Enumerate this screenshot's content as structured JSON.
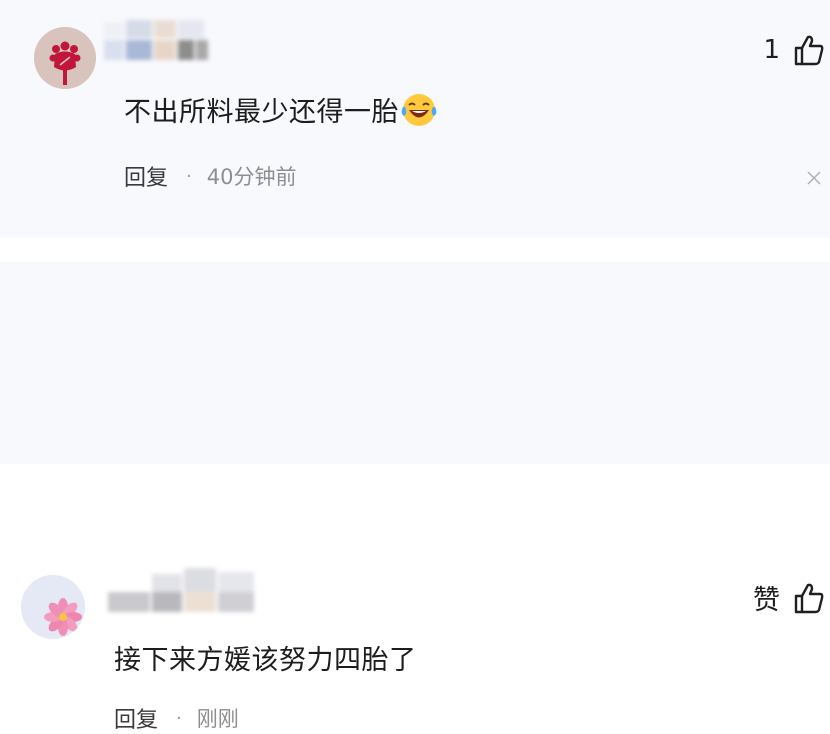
{
  "comments": [
    {
      "like_count": "1",
      "text": "不出所料最少还得一胎",
      "emoji": "laughing-with-tears",
      "reply_label": "回复",
      "separator": "·",
      "time": "40分钟前"
    },
    {
      "like_label": "赞",
      "text": "接下来方媛该努力四胎了",
      "reply_label": "回复",
      "separator": "·",
      "time": "刚刚"
    }
  ],
  "colors": {
    "card_bg": "#f8f9fd",
    "text": "#1d1d1d",
    "meta": "#8e8e8e",
    "avatar1_bg": "#d8c3bd",
    "avatar1_icon": "#c0163b"
  }
}
